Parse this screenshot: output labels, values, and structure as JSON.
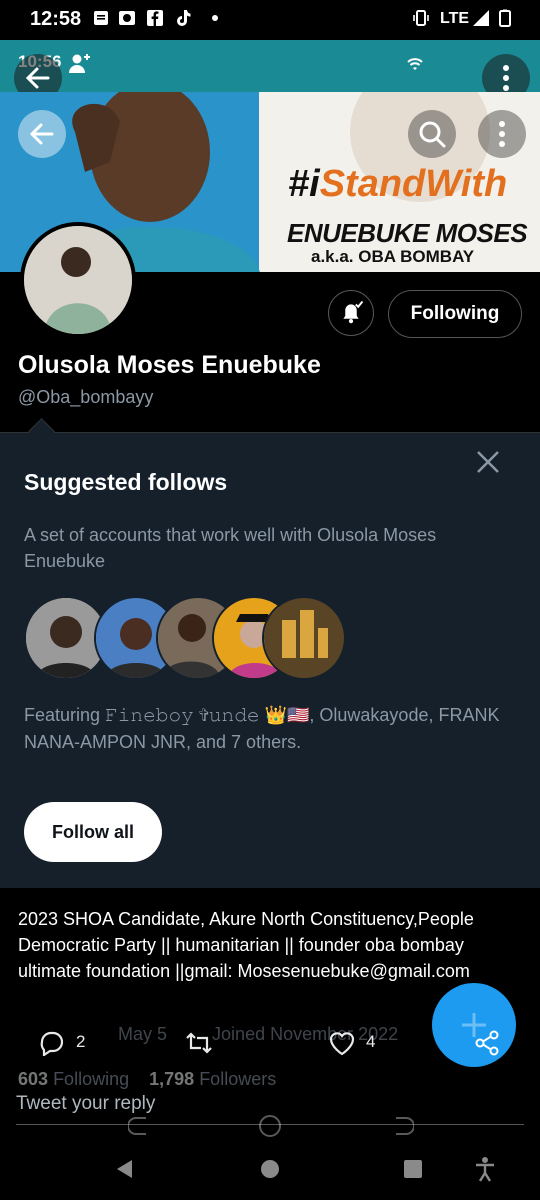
{
  "system_status": {
    "time": "12:58",
    "network": "LTE"
  },
  "inner_status": {
    "time": "10:56"
  },
  "banner": {
    "hashtag_prefix": "#i",
    "hashtag_highlight": "StandWith",
    "name": "ENUEBUKE MOSES",
    "aka": "a.k.a. OBA BOMBAY"
  },
  "profile": {
    "name": "Olusola Moses Enuebuke",
    "handle": "@Oba_bombayy",
    "following_label": "Following",
    "bio": "2023 SHOA Candidate, Akure North Constituency,People Democratic Party || humanitarian || founder oba bombay ultimate foundation ||gmail: Mosesenuebuke@gmail.com",
    "meta_born": "May 5",
    "meta_joined": "Joined November 2022",
    "following_count": "603",
    "following_label_text": "Following",
    "followers_count": "1,798",
    "followers_label_text": "Followers"
  },
  "suggested": {
    "title": "Suggested follows",
    "description": "A set of accounts that work well with Olusola Moses Enuebuke",
    "featuring": "Featuring 𝙵𝚒𝚗𝚎𝚋𝚘𝚢 ✞𝚞𝚗𝚍𝚎 👑🇺🇸, Oluwakayode, FRANK NANA-AMPON JNR, and 7 others.",
    "follow_all_label": "Follow all"
  },
  "tweet_actions": {
    "reply_count": "2",
    "like_count": "4"
  },
  "reply_placeholder": "Tweet your reply",
  "colors": {
    "accent": "#1d9bf0",
    "panel": "#15202b",
    "background": "#000000"
  }
}
